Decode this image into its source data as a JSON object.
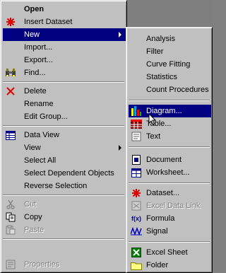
{
  "main_menu": {
    "open": "Open",
    "insert_dataset": "Insert Dataset",
    "new": "New",
    "import": "Import...",
    "export": "Export...",
    "find": "Find...",
    "delete": "Delete",
    "rename": "Rename",
    "edit_group": "Edit Group...",
    "data_view": "Data View",
    "view": "View",
    "select_all": "Select All",
    "select_dependent": "Select Dependent Objects",
    "reverse_selection": "Reverse Selection",
    "cut": "Cut",
    "copy": "Copy",
    "paste": "Paste",
    "properties": "Properties"
  },
  "sub_menu": {
    "analysis": "Analysis",
    "filter": "Filter",
    "curve_fitting": "Curve Fitting",
    "statistics": "Statistics",
    "count_procedures": "Count Procedures",
    "diagram": "Diagram...",
    "table": "Table...",
    "text": "Text",
    "document": "Document",
    "worksheet": "Worksheet...",
    "dataset": "Dataset...",
    "excel_data_link": "Excel Data Link",
    "formula": "Formula",
    "signal": "Signal",
    "excel_sheet": "Excel Sheet",
    "folder": "Folder"
  },
  "icons": {
    "formula_glyph": "f(x)"
  },
  "colors": {
    "selection": "#000080",
    "menu_face": "#c0c0c0",
    "disabled_text": "#808080"
  }
}
